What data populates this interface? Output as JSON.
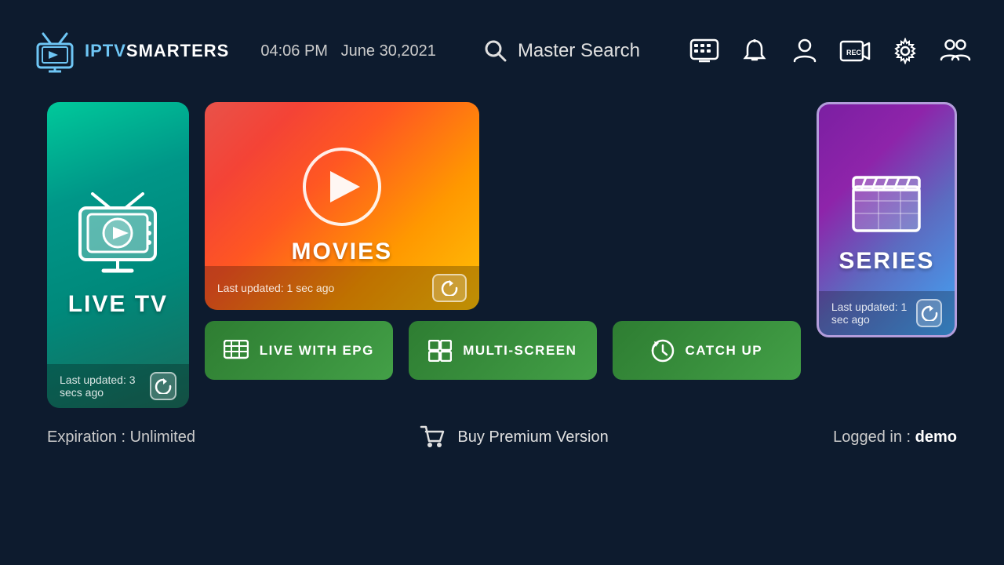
{
  "header": {
    "logo_text_iptv": "IPTV",
    "logo_text_smarters": "SMARTERS",
    "time": "04:06 PM",
    "date": "June 30,2021",
    "search_label": "Master Search",
    "icons": {
      "epg_icon": "EPG",
      "notification_icon": "🔔",
      "user_icon": "👤",
      "record_icon": "REC",
      "settings_icon": "⚙",
      "switch_user_icon": "👥"
    }
  },
  "cards": {
    "live_tv": {
      "label": "LIVE TV",
      "last_updated": "Last updated: 3 secs ago"
    },
    "movies": {
      "label": "MOVIES",
      "last_updated": "Last updated: 1 sec ago"
    },
    "series": {
      "label": "SERIES",
      "last_updated": "Last updated: 1 sec ago"
    }
  },
  "buttons": {
    "live_epg": "LIVE WITH EPG",
    "multi_screen": "MULTI-SCREEN",
    "catch_up": "CATCH UP"
  },
  "footer": {
    "expiration": "Expiration : Unlimited",
    "buy_premium": "Buy Premium Version",
    "logged_in_prefix": "Logged in : ",
    "logged_in_user": "demo"
  }
}
